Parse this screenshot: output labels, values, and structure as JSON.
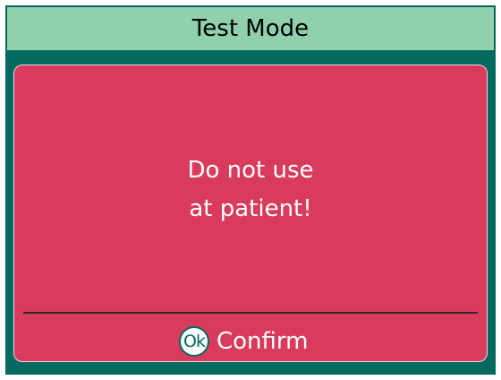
{
  "title_bar": {
    "title": "Test Mode"
  },
  "dialog": {
    "message_line_1": "Do not use",
    "message_line_2": "at patient!",
    "confirm": {
      "icon_label": "Ok",
      "label": "Confirm"
    }
  },
  "colors": {
    "title_bar_background": "#90d0ad",
    "frame_background": "#046a5f",
    "dialog_background": "#d83b5b",
    "text": "#ffffff"
  },
  "icons": {
    "confirm_icon": "ok-icon"
  }
}
